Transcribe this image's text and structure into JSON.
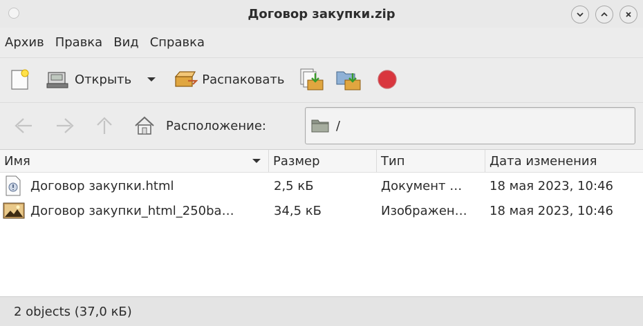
{
  "window": {
    "title": "Договор закупки.zip"
  },
  "menu": [
    "Архив",
    "Правка",
    "Вид",
    "Справка"
  ],
  "toolbar": {
    "open_label": "Открыть",
    "extract_label": "Распаковать",
    "icons": [
      "new-archive-icon",
      "open-archive-icon",
      "dropdown-arrow-icon",
      "extract-icon",
      "add-files-icon",
      "add-folder-icon",
      "stop-icon"
    ]
  },
  "location": {
    "label": "Расположение:",
    "path": "/"
  },
  "columns": {
    "name": "Имя",
    "size": "Размер",
    "type": "Тип",
    "modified": "Дата изменения"
  },
  "files": [
    {
      "name": "Договор закупки.html",
      "size": "2,5 кБ",
      "type": "Документ …",
      "modified": "18 мая 2023, 10:46",
      "icon": "html-document-icon"
    },
    {
      "name": "Договор закупки_html_250ba…",
      "size": "34,5 кБ",
      "type": "Изображен…",
      "modified": "18 мая 2023, 10:46",
      "icon": "image-file-icon"
    }
  ],
  "status": "2 objects (37,0 кБ)",
  "colors": {
    "window_bg": "#ececec",
    "list_bg": "#ffffff",
    "stop_red": "#d9363e"
  }
}
